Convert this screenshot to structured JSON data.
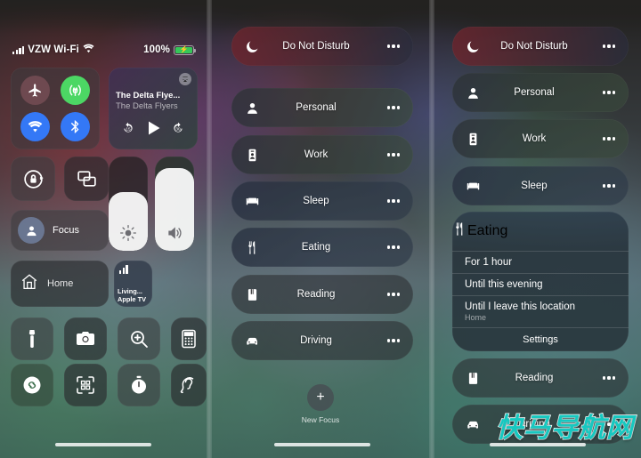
{
  "statusbar": {
    "carrier": "VZW Wi-Fi",
    "signal_icon": "cellular-bars-icon",
    "wifi_icon": "wifi-icon",
    "battery_percent": "100%",
    "battery_icon": "battery-charging-icon"
  },
  "panel1": {
    "connectivity": {
      "airplane": {
        "label": "Airplane Mode",
        "icon": "airplane-icon",
        "color": "#6e4950"
      },
      "cellular": {
        "label": "Cellular Data",
        "icon": "cellular-antenna-icon",
        "color": "#4cd764"
      },
      "wifi": {
        "label": "Wi-Fi",
        "icon": "wifi-icon",
        "color": "#3478f6"
      },
      "bluetooth": {
        "label": "Bluetooth",
        "icon": "bluetooth-icon",
        "color": "#3478f6"
      }
    },
    "media": {
      "title": "The Delta Flye...",
      "artist": "The Delta Flyers",
      "airplay_icon": "airplay-icon",
      "back_label": "15",
      "play_icon": "play-icon",
      "forward_label": "30"
    },
    "rotation_lock": {
      "label": "Rotation Lock",
      "icon": "rotation-lock-icon"
    },
    "screen_mirroring": {
      "label": "Screen Mirroring",
      "icon": "screen-mirroring-icon"
    },
    "focus": {
      "label": "Focus",
      "icon": "person-icon"
    },
    "brightness": {
      "label": "Brightness",
      "icon": "brightness-icon",
      "value": 62
    },
    "volume": {
      "label": "Volume",
      "icon": "speaker-icon",
      "value": 88
    },
    "home": {
      "label": "Home",
      "icon": "home-icon"
    },
    "appletv": {
      "line1": "Living...",
      "line2": "Apple TV",
      "icon": "now-playing-bars-icon"
    },
    "shortcuts": [
      {
        "name": "flashlight",
        "icon": "flashlight-icon"
      },
      {
        "name": "camera",
        "icon": "camera-icon"
      },
      {
        "name": "magnifier",
        "icon": "magnifier-icon"
      },
      {
        "name": "calculator",
        "icon": "calculator-icon"
      },
      {
        "name": "shazam",
        "icon": "shazam-icon"
      },
      {
        "name": "code-scanner",
        "icon": "qr-scanner-icon"
      },
      {
        "name": "timer",
        "icon": "timer-icon"
      },
      {
        "name": "hearing",
        "icon": "hearing-icon"
      }
    ]
  },
  "panel2": {
    "focus_modes": [
      {
        "label": "Do Not Disturb",
        "icon": "moon-icon",
        "tint": "tinted-red"
      },
      {
        "label": "Personal",
        "icon": "person-icon",
        "tint": "tinted-g"
      },
      {
        "label": "Work",
        "icon": "badge-icon",
        "tint": "tinted-g"
      },
      {
        "label": "Sleep",
        "icon": "bed-icon",
        "tint": "tinted-b"
      },
      {
        "label": "Eating",
        "icon": "fork-knife-icon",
        "tint": "tinted-b"
      },
      {
        "label": "Reading",
        "icon": "book-icon",
        "tint": ""
      },
      {
        "label": "Driving",
        "icon": "car-icon",
        "tint": ""
      }
    ],
    "more_icon": "more-dots-icon",
    "new_focus": {
      "label": "New Focus",
      "icon": "plus-icon"
    }
  },
  "panel3": {
    "focus_modes_top": [
      {
        "label": "Do Not Disturb",
        "icon": "moon-icon",
        "tint": "tinted-red"
      },
      {
        "label": "Personal",
        "icon": "person-icon",
        "tint": "tinted-g"
      },
      {
        "label": "Work",
        "icon": "badge-icon",
        "tint": "tinted-g"
      },
      {
        "label": "Sleep",
        "icon": "bed-icon",
        "tint": "tinted-b"
      }
    ],
    "expanded": {
      "label": "Eating",
      "icon": "fork-knife-icon",
      "more_icon": "more-dots-icon",
      "options": [
        {
          "title": "For 1 hour",
          "subtitle": ""
        },
        {
          "title": "Until this evening",
          "subtitle": ""
        },
        {
          "title": "Until I leave this location",
          "subtitle": "Home"
        }
      ],
      "settings_label": "Settings"
    },
    "focus_modes_bottom": [
      {
        "label": "Reading",
        "icon": "book-icon",
        "tint": ""
      },
      {
        "label": "Driving",
        "icon": "car-icon",
        "tint": ""
      }
    ]
  },
  "watermark": {
    "text": "快马导航网",
    "color": "#16c8c0"
  }
}
